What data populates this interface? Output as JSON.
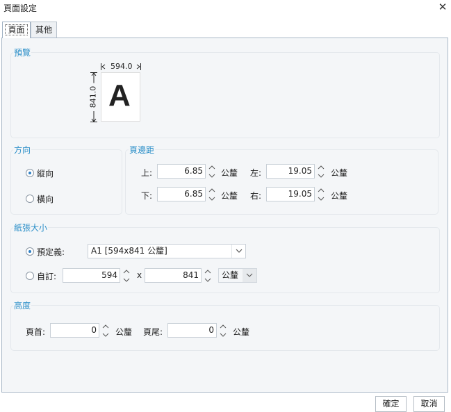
{
  "window": {
    "title": "頁面設定",
    "close_glyph": "✕"
  },
  "tabs": [
    {
      "label": "頁面",
      "active": true
    },
    {
      "label": "其他",
      "active": false
    }
  ],
  "preview": {
    "title": "預覽",
    "width_label": "594.0",
    "height_label": "841.0",
    "letter": "A"
  },
  "orientation": {
    "title": "方向",
    "options": [
      {
        "label": "縱向",
        "selected": true
      },
      {
        "label": "橫向",
        "selected": false
      }
    ]
  },
  "margins": {
    "title": "頁邊距",
    "top": {
      "label": "上:",
      "value": "6.85",
      "unit": "公釐"
    },
    "left": {
      "label": "左:",
      "value": "19.05",
      "unit": "公釐"
    },
    "bottom": {
      "label": "下:",
      "value": "6.85",
      "unit": "公釐"
    },
    "right": {
      "label": "右:",
      "value": "19.05",
      "unit": "公釐"
    }
  },
  "paper_size": {
    "title": "紙張大小",
    "predefined": {
      "label": "預定義:",
      "selected": true,
      "value": "A1 [594x841 公釐]"
    },
    "custom": {
      "label": "自訂:",
      "selected": false,
      "width": "594",
      "times": "x",
      "height": "841",
      "unit": "公釐"
    }
  },
  "height": {
    "title": "高度",
    "header": {
      "label": "頁首:",
      "value": "0",
      "unit": "公釐"
    },
    "footer": {
      "label": "頁尾:",
      "value": "0",
      "unit": "公釐"
    }
  },
  "buttons": {
    "ok": "確定",
    "cancel": "取消"
  }
}
